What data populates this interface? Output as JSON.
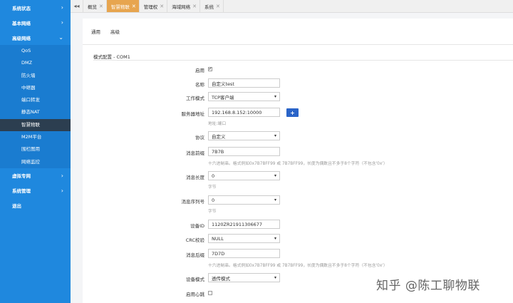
{
  "sidebar": {
    "items": [
      {
        "label": "系统状态",
        "chev": "›"
      },
      {
        "label": "基本网络",
        "chev": "›"
      },
      {
        "label": "高级网络",
        "chev": "⌄"
      }
    ],
    "sub": [
      {
        "label": "QoS"
      },
      {
        "label": "DMZ"
      },
      {
        "label": "防火墙"
      },
      {
        "label": "中继器"
      },
      {
        "label": "端口转发"
      },
      {
        "label": "静态NAT"
      },
      {
        "label": "智慧物联"
      },
      {
        "label": "M2M平台"
      },
      {
        "label": "围栏图用"
      },
      {
        "label": "网络监控"
      }
    ],
    "items2": [
      {
        "label": "虚拟专网",
        "chev": "›"
      },
      {
        "label": "系统管理",
        "chev": "›"
      },
      {
        "label": "退出",
        "chev": ""
      }
    ]
  },
  "tabbar": {
    "nav": "◂◂",
    "tabs": [
      {
        "label": "概览",
        "close": "✕"
      },
      {
        "label": "智慧物联",
        "close": "✕"
      },
      {
        "label": "管理权",
        "close": "✕"
      },
      {
        "label": "海域网络",
        "close": "✕"
      },
      {
        "label": "系统",
        "close": "✕"
      }
    ]
  },
  "subtabs": {
    "general": "通用",
    "advanced": "高级"
  },
  "section": {
    "title": "模式配置 - COM1"
  },
  "form": {
    "enable_label": "启用",
    "enable_check": "✔",
    "name_label": "名称",
    "name_value": "自定义test",
    "workmode_label": "工作模式",
    "workmode_value": "TCP客户端",
    "server_label": "服务器地址",
    "server_value": "192.168.8.152:10000",
    "add_btn": "+",
    "server_help": "地址:端口",
    "protocol_label": "协议",
    "protocol_value": "自定义",
    "msghead_label": "消息前缀",
    "msghead_value": "7B7B",
    "msghead_help": "十六进制串。格式例如0x7B7BFF99 或 7B7BFF99，长度为偶数且不多于8个字符（不包含'0x'）",
    "msglen_label": "消息长度",
    "msglen_value": "0",
    "msglen_help": "字节",
    "msgseq_label": "消息序列号",
    "msgseq_value": "0",
    "msgseq_help": "字节",
    "deviceid_label": "设备ID",
    "deviceid_value": "1120ZR21911306677",
    "crc_label": "CRC校验",
    "crc_value": "NULL",
    "msgtail_label": "消息后缀",
    "msgtail_value": "7D7D",
    "msgtail_help": "十六进制串。格式例如0x7B7BFF99 或 7B7BFF99，长度为偶数且不多于8个字符（不包含'0x'）",
    "devmode_label": "设备模式",
    "devmode_value": "透传模式",
    "heartbeat_label": "启用心跳"
  },
  "watermark": "知乎 @陈工聊物联",
  "colors": {
    "sidebar": "#1f88de",
    "active_tab": "#e7a54f",
    "active_nav": "#2c3e50",
    "button": "#2a64c8"
  }
}
